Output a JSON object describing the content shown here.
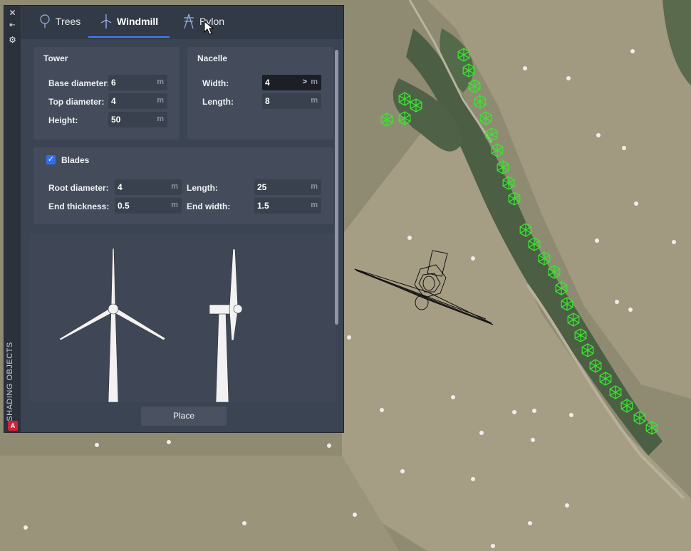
{
  "palette": {
    "title": "SHADING OBJECTS",
    "tabs": [
      {
        "label": "Trees",
        "icon": "tree-icon",
        "active": false
      },
      {
        "label": "Windmill",
        "icon": "windmill-icon",
        "active": true
      },
      {
        "label": "Pylon",
        "icon": "pylon-icon",
        "active": false
      }
    ],
    "tower": {
      "title": "Tower",
      "base_diameter": {
        "label": "Base diameter:",
        "value": "6",
        "unit": "m"
      },
      "top_diameter": {
        "label": "Top diameter:",
        "value": "4",
        "unit": "m"
      },
      "height": {
        "label": "Height:",
        "value": "50",
        "unit": "m"
      }
    },
    "nacelle": {
      "title": "Nacelle",
      "width": {
        "label": "Width:",
        "value": "4",
        "unit": "m"
      },
      "length": {
        "label": "Length:",
        "value": "8",
        "unit": "m"
      }
    },
    "blades": {
      "title": "Blades",
      "enabled": true,
      "root_diameter": {
        "label": "Root diameter:",
        "value": "4",
        "unit": "m"
      },
      "length": {
        "label": "Length:",
        "value": "25",
        "unit": "m"
      },
      "end_thickness": {
        "label": "End thickness:",
        "value": "0.5",
        "unit": "m"
      },
      "end_width": {
        "label": "End width:",
        "value": "1.5",
        "unit": "m"
      }
    },
    "place_button": "Place",
    "brand_letter": "A"
  },
  "colors": {
    "accent": "#3d7eff",
    "marker_green": "#36e62e",
    "panel_bg": "#3b4453"
  }
}
